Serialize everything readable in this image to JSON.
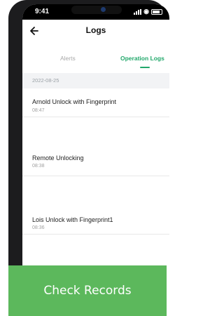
{
  "status_bar": {
    "time": "9:41"
  },
  "navbar": {
    "title": "Logs"
  },
  "tabs": [
    {
      "label": "Alerts",
      "active": false
    },
    {
      "label": "Operation Logs",
      "active": true
    }
  ],
  "logs": {
    "date": "2022-08-25",
    "entries": [
      {
        "title": "Arnold Unlock with Fingerprint",
        "time": "08:47"
      },
      {
        "title": "Remote Unlocking",
        "time": "08:38"
      },
      {
        "title": "Lois Unlock with Fingerprint1",
        "time": "08:36"
      }
    ]
  },
  "cta": {
    "label": "Check Records"
  },
  "colors": {
    "accent": "#22a86b",
    "button": "#5cb85c"
  }
}
